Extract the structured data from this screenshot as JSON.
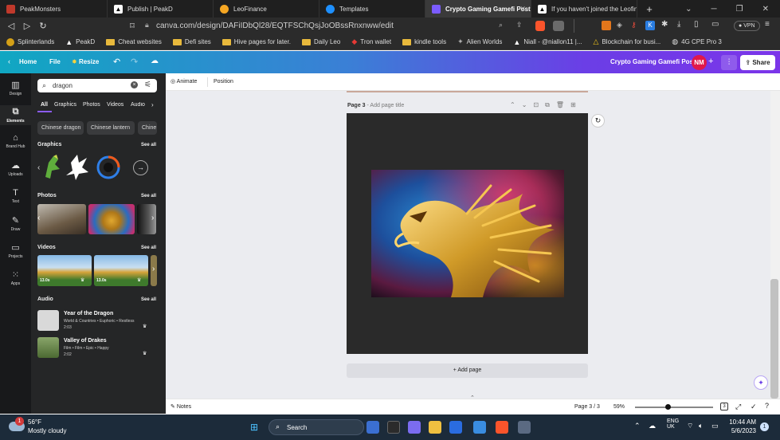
{
  "browser": {
    "tabs": [
      {
        "title": "PeakMonsters",
        "icon": "peakmonsters-icon",
        "color": "#c0392b",
        "active": false
      },
      {
        "title": "Publish | PeakD",
        "icon": "peakd-icon",
        "color": "#ffffff",
        "active": false
      },
      {
        "title": "LeoFinance",
        "icon": "leofinance-icon",
        "color": "#f5a623",
        "active": false
      },
      {
        "title": "Templates",
        "icon": "canva-icon",
        "color": "#1e90ff",
        "active": false
      },
      {
        "title": "Crypto Gaming Gamefi Post",
        "icon": "canva-icon",
        "color": "#7b5cff",
        "active": true
      },
      {
        "title": "If you haven't joined the Leofina",
        "icon": "peakd-icon",
        "color": "#ffffff",
        "active": false
      }
    ],
    "new_tab": "+",
    "url": "canva.com/design/DAFiIDbQl28/EQTFSChQsjJoOBssRnxnww/edit",
    "vpn_label": "VPN",
    "bookmarks": [
      {
        "label": "Splinterlands",
        "type": "site"
      },
      {
        "label": "PeakD",
        "type": "site"
      },
      {
        "label": "Cheat websites",
        "type": "folder"
      },
      {
        "label": "Defi sites",
        "type": "folder"
      },
      {
        "label": "Hive pages for later.",
        "type": "folder"
      },
      {
        "label": "Daily Leo",
        "type": "folder"
      },
      {
        "label": "Tron wallet",
        "type": "site"
      },
      {
        "label": "kindle tools",
        "type": "folder"
      },
      {
        "label": "Alien Worlds",
        "type": "site"
      },
      {
        "label": "Niall - @niallon11 |...",
        "type": "site"
      },
      {
        "label": "Blockchain for busi...",
        "type": "site"
      },
      {
        "label": "4G CPE Pro 3",
        "type": "site"
      }
    ]
  },
  "canva": {
    "home": "Home",
    "file": "File",
    "resize": "Resize",
    "design_title": "Crypto Gaming Gamefi Post",
    "avatar": "NM",
    "share": "Share",
    "left_nav": [
      "Design",
      "Elements",
      "Brand Hub",
      "Uploads",
      "Text",
      "Draw",
      "Projects",
      "Apps"
    ],
    "search_value": "dragon",
    "filter_tabs": [
      "All",
      "Graphics",
      "Photos",
      "Videos",
      "Audio"
    ],
    "chips": [
      "Chinese dragon",
      "Chinese lantern",
      "Chine"
    ],
    "sections": {
      "graphics": "Graphics",
      "photos": "Photos",
      "videos": "Videos",
      "audio": "Audio",
      "see_all": "See all"
    },
    "video_durations": [
      "13.0s",
      "13.0s"
    ],
    "audio_items": [
      {
        "title": "Year of the Dragon",
        "meta": "World & Countries • Euphoric • Restless",
        "duration": "2:03"
      },
      {
        "title": "Valley of Drakes",
        "meta": "Film • Film • Epic • Happy",
        "duration": "2:02"
      }
    ],
    "toolbar": {
      "animate": "Animate",
      "position": "Position"
    },
    "page_label": "Page 3",
    "page_title_placeholder": "- Add page title",
    "add_page": "+ Add page",
    "notes": "Notes",
    "page_count": "Page 3 / 3",
    "zoom": "59%"
  },
  "taskbar": {
    "temp": "56°F",
    "weather": "Mostly cloudy",
    "search": "Search",
    "lang1": "ENG",
    "lang2": "UK",
    "time": "10:44 AM",
    "date": "5/6/2023",
    "notif_count": "1"
  }
}
